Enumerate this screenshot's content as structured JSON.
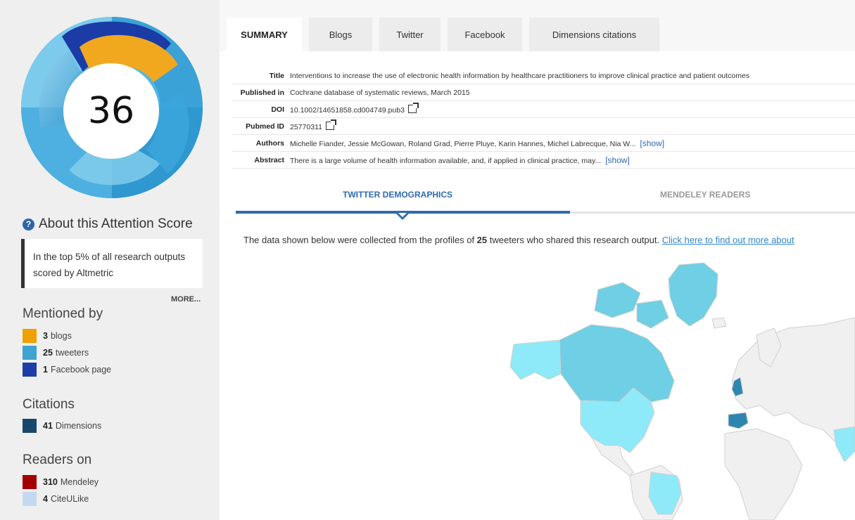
{
  "score": {
    "value": "36"
  },
  "donut_colors": {
    "blogs": "#f5a623",
    "twitter": "#4aa8d8",
    "facebook": "#1d3ea8"
  },
  "about": {
    "label": "About this Attention Score",
    "icon": "question-circle-icon"
  },
  "top_box": {
    "text": "In the top 5% of all research outputs scored by Altmetric"
  },
  "more_label": "MORE...",
  "mentioned": {
    "title": "Mentioned by",
    "items": [
      {
        "count": "3",
        "label": "blogs",
        "color": "#f0a000"
      },
      {
        "count": "25",
        "label": "tweeters",
        "color": "#3fa3d1"
      },
      {
        "count": "1",
        "label": "Facebook page",
        "color": "#1d3ea8"
      }
    ]
  },
  "citations": {
    "title": "Citations",
    "items": [
      {
        "count": "41",
        "label": "Dimensions",
        "color": "#17486b"
      }
    ]
  },
  "readers": {
    "title": "Readers on",
    "items": [
      {
        "count": "310",
        "label": "Mendeley",
        "color": "#a40000"
      },
      {
        "count": "4",
        "label": "CiteULike",
        "color": "#c4d8f0"
      }
    ]
  },
  "tabs": [
    "SUMMARY",
    "Blogs",
    "Twitter",
    "Facebook",
    "Dimensions citations"
  ],
  "meta": {
    "title_k": "Title",
    "title_v": "Interventions to increase the use of electronic health information by healthcare practitioners to improve clinical practice and patient outcomes",
    "pub_k": "Published in",
    "pub_v": "Cochrane database of systematic reviews, March 2015",
    "doi_k": "DOI",
    "doi_v": "10.1002/14651858.cd004749.pub3",
    "pmid_k": "Pubmed ID",
    "pmid_v": "25770311",
    "authors_k": "Authors",
    "authors_v": "Michelle Fiander, Jessie McGowan, Roland Grad, Pierre Pluye, Karin Hannes, Michel Labrecque, Nia W...",
    "abstract_k": "Abstract",
    "abstract_v": "There is a large volume of health information available, and, if applied in clinical practice, may...",
    "show_label": "[show]"
  },
  "subtabs": {
    "active": "TWITTER DEMOGRAPHICS",
    "inactive": "MENDELEY READERS"
  },
  "desc": {
    "pre": "The data shown below were collected from the profiles of ",
    "count": "25",
    "post": " tweeters who shared this research output. ",
    "link": "Click here to find out more about"
  },
  "map_colors": {
    "land": "#f0f0f0",
    "border": "#cfcfcf",
    "light": "#8eeaf8",
    "mid": "#6fcfe4",
    "dark": "#2e86b0"
  }
}
